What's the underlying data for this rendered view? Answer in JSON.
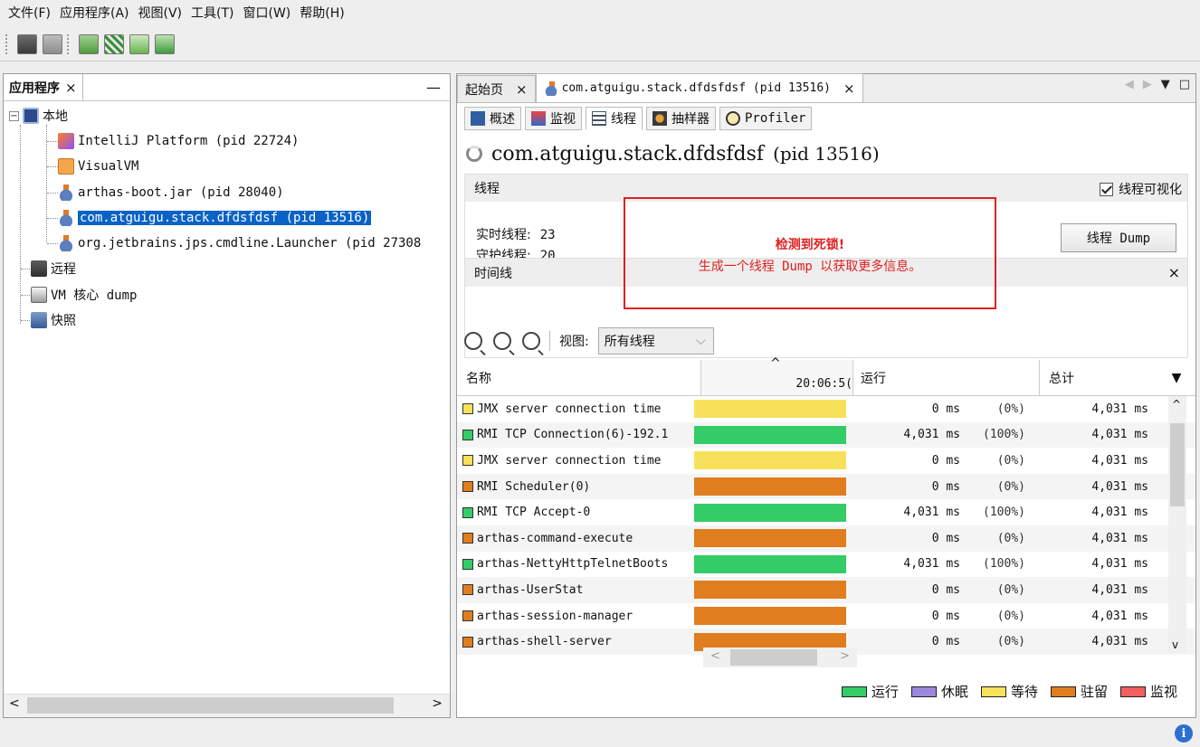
{
  "menu": [
    "文件(F)",
    "应用程序(A)",
    "视图(V)",
    "工具(T)",
    "窗口(W)",
    "帮助(H)"
  ],
  "left_panel": {
    "tab_label": "应用程序",
    "tree": {
      "local": "本地",
      "local_children": [
        {
          "label": "IntelliJ Platform (pid 22724)",
          "icon": "intellij-icon"
        },
        {
          "label": "VisualVM",
          "icon": "visualvm-icon"
        },
        {
          "label": "arthas-boot.jar (pid 28040)",
          "icon": "java-icon"
        },
        {
          "label": "com.atguigu.stack.dfdsfdsf (pid 13516)",
          "icon": "java-icon",
          "selected": true
        },
        {
          "label": "org.jetbrains.jps.cmdline.Launcher (pid 27308",
          "icon": "java-icon"
        }
      ],
      "remote": "远程",
      "vm_dump": "VM 核心 dump",
      "snapshots": "快照"
    }
  },
  "doc_tabs": {
    "start": "起始页",
    "process": "com.atguigu.stack.dfdsfdsf (pid 13516)"
  },
  "sub_tabs": [
    "概述",
    "监视",
    "线程",
    "抽样器",
    "Profiler"
  ],
  "process_title": {
    "name": "com.atguigu.stack.dfdsfdsf",
    "pid": "(pid 13516)"
  },
  "threads": {
    "section_title": "线程",
    "visualize_label": "线程可视化",
    "live_label": "实时线程:",
    "live_value": "23",
    "daemon_label": "守护线程:",
    "daemon_value": "20",
    "dump_button": "线程 Dump"
  },
  "deadlock": {
    "line1": "检测到死锁!",
    "line2": "生成一个线程 Dump 以获取更多信息。"
  },
  "timeline": {
    "title": "时间线",
    "view_label": "视图:",
    "view_value": "所有线程",
    "columns": {
      "name": "名称",
      "time": "20:06:5(",
      "run": "运行",
      "total": "总计"
    },
    "rows": [
      {
        "name": "JMX server connection time",
        "state": "wait",
        "run": "0 ms",
        "pct": "(0%)",
        "total": "4,031 ms"
      },
      {
        "name": "RMI TCP Connection(6)-192.1",
        "state": "run",
        "run": "4,031 ms",
        "pct": "(100%)",
        "total": "4,031 ms"
      },
      {
        "name": "JMX server connection time",
        "state": "wait",
        "run": "0 ms",
        "pct": "(0%)",
        "total": "4,031 ms"
      },
      {
        "name": "RMI Scheduler(0)",
        "state": "park",
        "run": "0 ms",
        "pct": "(0%)",
        "total": "4,031 ms"
      },
      {
        "name": "RMI TCP Accept-0",
        "state": "run",
        "run": "4,031 ms",
        "pct": "(100%)",
        "total": "4,031 ms"
      },
      {
        "name": "arthas-command-execute",
        "state": "park",
        "run": "0 ms",
        "pct": "(0%)",
        "total": "4,031 ms"
      },
      {
        "name": "arthas-NettyHttpTelnetBoots",
        "state": "run",
        "run": "4,031 ms",
        "pct": "(100%)",
        "total": "4,031 ms"
      },
      {
        "name": "arthas-UserStat",
        "state": "park",
        "run": "0 ms",
        "pct": "(0%)",
        "total": "4,031 ms"
      },
      {
        "name": "arthas-session-manager",
        "state": "park",
        "run": "0 ms",
        "pct": "(0%)",
        "total": "4,031 ms"
      },
      {
        "name": "arthas-shell-server",
        "state": "park",
        "run": "0 ms",
        "pct": "(0%)",
        "total": "4,031 ms"
      }
    ],
    "legend": [
      {
        "label": "运行",
        "color": "#33cc66"
      },
      {
        "label": "休眠",
        "color": "#9b88dd"
      },
      {
        "label": "等待",
        "color": "#f7e15b"
      },
      {
        "label": "驻留",
        "color": "#e07d1f"
      },
      {
        "label": "监视",
        "color": "#f06060"
      }
    ]
  },
  "colors": {
    "run": "#33cc66",
    "wait": "#f7e15b",
    "park": "#e07d1f",
    "selection": "#0a62c6",
    "deadlock": "#e02020"
  }
}
